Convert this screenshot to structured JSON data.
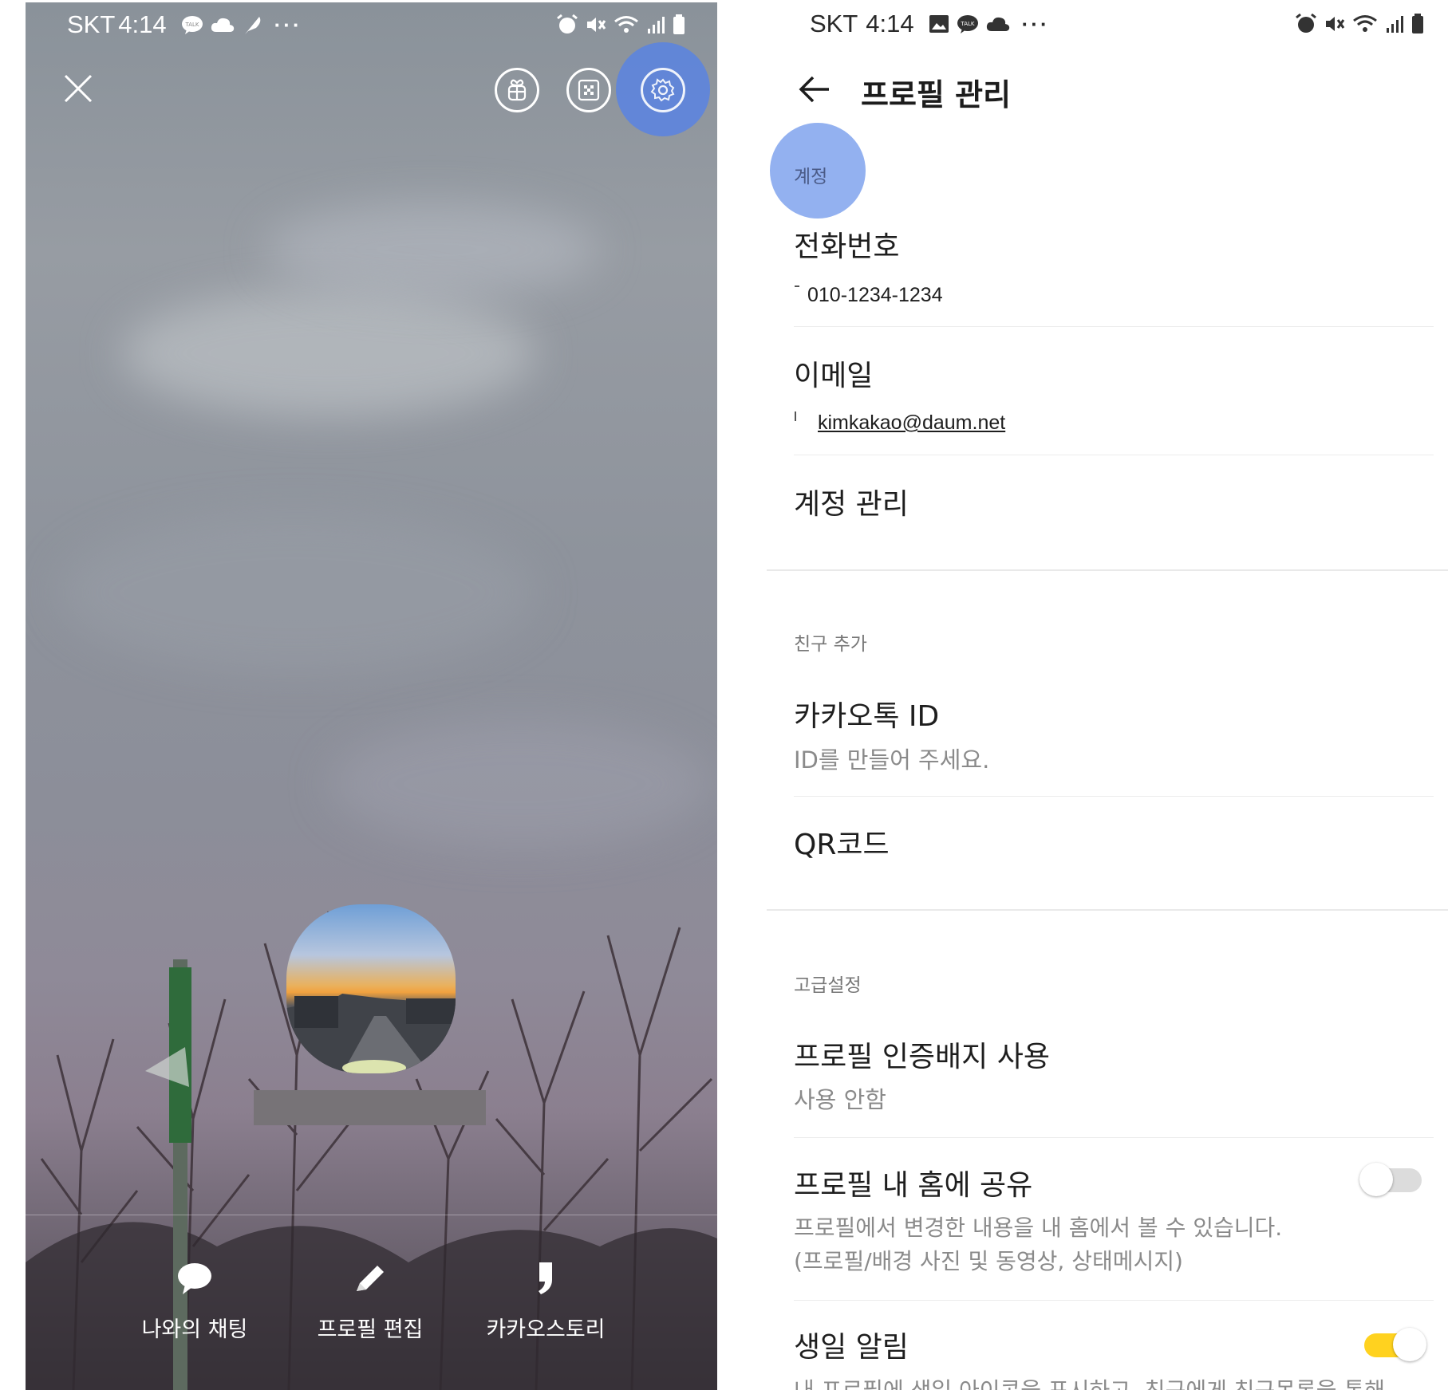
{
  "left": {
    "status": {
      "carrier": "SKT",
      "time": "4:14",
      "talk_badge": "TALK"
    },
    "actions": [
      {
        "label": "나와의 채팅",
        "icon": "chat-bubble-icon"
      },
      {
        "label": "프로필 편집",
        "icon": "pencil-icon"
      },
      {
        "label": "카카오스토리",
        "icon": "kakaostory-icon"
      }
    ]
  },
  "right": {
    "status": {
      "carrier": "SKT",
      "time": "4:14",
      "talk_badge": "TALK"
    },
    "title": "프로필 관리",
    "sections": {
      "account": {
        "header": "계정",
        "phone_label": "전화번호",
        "phone_value": "010-1234-1234",
        "email_label": "이메일",
        "email_value": "kimkakao@daum.net",
        "account_manage": "계정 관리"
      },
      "add_friend": {
        "header": "친구 추가",
        "kakao_id_label": "카카오톡 ID",
        "kakao_id_sub": "ID를 만들어 주세요.",
        "qr_label": "QR코드"
      },
      "advanced": {
        "header": "고급설정",
        "badge_label": "프로필 인증배지 사용",
        "badge_sub": "사용 안함",
        "share_label": "프로필 내 홈에 공유",
        "share_sub1": "프로필에서 변경한 내용을 내 홈에서 볼 수 있습니다.",
        "share_sub2": "(프로필/배경 사진 및 동영상, 상태메시지)",
        "share_enabled": false,
        "birthday_label": "생일 알림",
        "birthday_sub": "내 프로필에 생일 아이콘을 표시하고, 친구에게 친구목록을 통해",
        "birthday_enabled": true
      }
    },
    "colors": {
      "toggle_on": "#FFD21F",
      "toggle_off": "#dcdcdc",
      "highlight": "#5882E4"
    }
  }
}
